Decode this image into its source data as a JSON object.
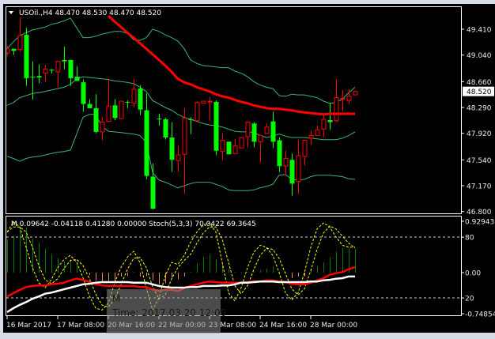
{
  "window": {
    "symbol_header": "USOil.,H4  48.470 48.530 48.470 48.520"
  },
  "colors": {
    "bull": "#ff0000",
    "bear": "#00ff00",
    "bands": "#3cb371",
    "ma": "#ff0000",
    "hist_up": "#008000",
    "hist_down": "#f08060",
    "signal": "#ff0000",
    "main": "#ffffff",
    "stoch": "#ffff00",
    "background": "#000000",
    "current_price_tag": "#ffffff"
  },
  "chart_data": [
    {
      "type": "candlestick",
      "title": "USOil.,H4",
      "ylim": [
        46.8,
        49.63
      ],
      "y_ticks": [
        "49.410",
        "49.040",
        "48.660",
        "48.290",
        "47.920",
        "47.540",
        "47.170",
        "46.800"
      ],
      "current_price": "48.520",
      "candles_ohlc": [
        [
          49.07,
          49.17,
          49.04,
          49.13
        ],
        [
          49.13,
          49.13,
          49.04,
          49.1
        ],
        [
          49.12,
          49.58,
          49.09,
          49.32
        ],
        [
          49.33,
          49.43,
          48.6,
          48.71
        ],
        [
          48.73,
          48.95,
          48.4,
          48.72
        ],
        [
          48.74,
          48.91,
          48.64,
          48.72
        ],
        [
          48.78,
          48.9,
          48.66,
          48.84
        ],
        [
          48.83,
          48.84,
          48.78,
          48.82
        ],
        [
          48.8,
          48.96,
          48.58,
          48.95
        ],
        [
          48.97,
          49.16,
          48.84,
          48.95
        ],
        [
          48.97,
          48.97,
          48.6,
          48.71
        ],
        [
          48.73,
          48.88,
          48.67,
          48.67
        ],
        [
          48.65,
          48.69,
          48.23,
          48.34
        ],
        [
          48.34,
          48.41,
          48.28,
          48.28
        ],
        [
          48.28,
          48.48,
          47.92,
          47.94
        ],
        [
          47.94,
          48.15,
          47.82,
          48.08
        ],
        [
          48.09,
          48.7,
          48.08,
          48.31
        ],
        [
          48.32,
          48.41,
          48.11,
          48.14
        ],
        [
          48.13,
          48.38,
          48.13,
          48.38
        ],
        [
          48.37,
          48.39,
          48.28,
          48.36
        ],
        [
          48.35,
          48.7,
          48.29,
          48.55
        ],
        [
          48.56,
          48.61,
          48.18,
          48.26
        ],
        [
          48.25,
          48.49,
          47.26,
          47.31
        ],
        [
          47.3,
          47.49,
          46.83,
          46.84
        ],
        [
          48.13,
          48.2,
          48.03,
          48.12
        ],
        [
          48.12,
          48.14,
          47.83,
          47.86
        ],
        [
          47.86,
          48.08,
          47.37,
          47.54
        ],
        [
          47.53,
          47.75,
          47.37,
          47.61
        ],
        [
          47.62,
          48.28,
          47.05,
          48.14
        ],
        [
          48.12,
          48.15,
          47.91,
          48.11
        ],
        [
          48.1,
          48.38,
          48.1,
          48.36
        ],
        [
          48.35,
          48.38,
          48.35,
          48.38
        ],
        [
          48.37,
          48.44,
          48.1,
          48.38
        ],
        [
          48.37,
          48.39,
          47.61,
          47.67
        ],
        [
          47.66,
          47.92,
          47.54,
          47.82
        ],
        [
          47.8,
          47.8,
          47.62,
          47.62
        ],
        [
          47.63,
          47.84,
          47.63,
          47.74
        ],
        [
          47.71,
          47.86,
          47.71,
          47.86
        ],
        [
          47.87,
          48.08,
          47.72,
          48.08
        ],
        [
          48.06,
          48.08,
          47.72,
          47.8
        ],
        [
          47.8,
          47.89,
          47.5,
          47.89
        ],
        [
          47.92,
          48.06,
          47.92,
          48.01
        ],
        [
          48.09,
          48.23,
          47.71,
          47.8
        ],
        [
          47.82,
          47.86,
          47.37,
          47.45
        ],
        [
          47.45,
          47.67,
          47.31,
          47.56
        ],
        [
          47.54,
          47.63,
          47.03,
          47.2
        ],
        [
          47.23,
          47.82,
          47.05,
          47.6
        ],
        [
          47.59,
          47.82,
          47.46,
          47.82
        ],
        [
          47.85,
          47.96,
          47.76,
          47.89
        ],
        [
          47.89,
          48.03,
          47.89,
          47.97
        ],
        [
          47.98,
          48.21,
          47.86,
          48.12
        ],
        [
          48.11,
          48.36,
          47.97,
          48.08
        ],
        [
          48.1,
          48.7,
          48.08,
          48.43
        ],
        [
          48.41,
          48.54,
          48.23,
          48.42
        ],
        [
          48.39,
          48.55,
          48.34,
          48.45
        ],
        [
          48.47,
          48.53,
          48.47,
          48.52
        ]
      ],
      "moving_average": [
        null,
        null,
        null,
        null,
        null,
        null,
        null,
        null,
        null,
        null,
        null,
        null,
        null,
        null,
        null,
        null,
        49.6,
        49.52,
        49.44,
        49.36,
        49.29,
        49.21,
        49.13,
        49.05,
        48.97,
        48.89,
        48.8,
        48.7,
        48.65,
        48.62,
        48.58,
        48.55,
        48.52,
        48.48,
        48.45,
        48.43,
        48.4,
        48.37,
        48.35,
        48.32,
        48.3,
        48.28,
        48.27,
        48.27,
        48.26,
        48.25,
        48.23,
        48.22,
        48.21,
        48.2,
        48.19,
        48.2,
        48.2,
        48.2,
        48.2,
        48.2
      ],
      "bollinger_upper": [
        49.13,
        49.23,
        49.32,
        49.36,
        49.4,
        49.42,
        49.44,
        49.48,
        49.5,
        49.53,
        49.57,
        49.43,
        49.29,
        49.29,
        49.31,
        49.34,
        49.36,
        49.38,
        49.38,
        49.35,
        49.26,
        49.25,
        49.29,
        49.41,
        49.38,
        49.33,
        49.29,
        49.24,
        49.13,
        48.97,
        48.92,
        48.89,
        48.88,
        48.87,
        48.86,
        48.86,
        48.81,
        48.78,
        48.73,
        48.66,
        48.61,
        48.58,
        48.56,
        48.46,
        48.45,
        48.48,
        48.47,
        48.47,
        48.45,
        48.43,
        48.38,
        48.35,
        48.36,
        48.41,
        48.5,
        48.58
      ],
      "bollinger_middle": [
        48.32,
        48.36,
        48.43,
        48.46,
        48.49,
        48.5,
        48.52,
        48.54,
        48.56,
        48.58,
        48.62,
        48.7,
        48.73,
        48.72,
        48.71,
        48.7,
        48.69,
        48.67,
        48.66,
        48.65,
        48.63,
        48.58,
        48.52,
        48.39,
        48.34,
        48.29,
        48.25,
        48.19,
        48.15,
        48.12,
        48.09,
        48.06,
        48.04,
        48.03,
        48.01,
        47.98,
        47.95,
        47.94,
        47.94,
        47.93,
        47.89,
        47.86,
        47.88,
        47.91,
        47.88,
        47.86,
        47.86,
        47.86,
        47.85,
        47.84,
        47.83,
        47.83,
        47.83,
        47.85,
        47.89,
        47.94
      ],
      "bollinger_lower": [
        47.59,
        47.56,
        47.52,
        47.56,
        47.58,
        47.59,
        47.61,
        47.63,
        47.65,
        47.66,
        47.68,
        47.91,
        48.15,
        48.19,
        48.19,
        48.02,
        47.95,
        47.94,
        47.93,
        47.92,
        47.91,
        47.89,
        47.79,
        47.36,
        47.25,
        47.22,
        47.18,
        47.14,
        47.17,
        47.2,
        47.22,
        47.22,
        47.22,
        47.19,
        47.16,
        47.11,
        47.1,
        47.1,
        47.1,
        47.11,
        47.14,
        47.16,
        47.19,
        47.32,
        47.33,
        47.26,
        47.25,
        47.26,
        47.3,
        47.32,
        47.32,
        47.32,
        47.31,
        47.3,
        47.27,
        47.26
      ],
      "x_ticks": [
        "16 Mar 2017",
        "17 Mar 08:00",
        "20 Mar 16:00",
        "22 Mar 00:00",
        "23 Mar 08:00",
        "24 Mar 16:00",
        "28 Mar 00:00"
      ]
    },
    {
      "type": "indicator",
      "header": "M 0.09642 -0.04118 0.41280 0.00000  Stoch(5,3,3) 70.0422 69.3645",
      "ylim": [
        -0.74854,
        0.92943
      ],
      "y_ticks": [
        "0.92943",
        "80",
        "0.00",
        "20",
        "-0.74854"
      ],
      "stoch_levels": [
        80,
        20
      ],
      "histogram": [
        0.6,
        0.67,
        0.78,
        0.81,
        0.61,
        0.54,
        0.43,
        0.33,
        0.26,
        0.2,
        0.24,
        0.14,
        0.04,
        -0.04,
        -0.14,
        -0.16,
        -0.18,
        -0.19,
        -0.07,
        -0.06,
        0.02,
        -0.07,
        -0.06,
        -0.14,
        -0.21,
        -0.19,
        -0.09,
        -0.12,
        -0.07,
        0.02,
        0.17,
        0.28,
        0.33,
        0.24,
        0.17,
        0.07,
        0.02,
        0.01,
        0.01,
        0.01,
        0.04,
        0.07,
        0.11,
        0.02,
        0.01,
        -0.1,
        -0.07,
        -0.07,
        0.07,
        0.11,
        0.18,
        0.27,
        0.38,
        0.44,
        0.44,
        0.43
      ],
      "signal_line": [
        -0.43,
        -0.37,
        -0.31,
        -0.26,
        -0.24,
        -0.23,
        -0.23,
        -0.21,
        -0.2,
        -0.18,
        -0.14,
        -0.11,
        -0.13,
        -0.17,
        -0.21,
        -0.23,
        -0.24,
        -0.24,
        -0.24,
        -0.24,
        -0.24,
        -0.26,
        -0.26,
        -0.3,
        -0.33,
        -0.31,
        -0.31,
        -0.33,
        -0.28,
        -0.24,
        -0.21,
        -0.18,
        -0.16,
        -0.17,
        -0.18,
        -0.18,
        -0.18,
        -0.18,
        -0.17,
        -0.16,
        -0.16,
        -0.14,
        -0.14,
        -0.16,
        -0.17,
        -0.2,
        -0.21,
        -0.21,
        -0.18,
        -0.14,
        -0.1,
        -0.04,
        -0.01,
        0.01,
        0.06,
        0.1
      ],
      "main_line": [
        -0.71,
        -0.64,
        -0.58,
        -0.53,
        -0.47,
        -0.43,
        -0.38,
        -0.36,
        -0.33,
        -0.3,
        -0.27,
        -0.24,
        -0.21,
        -0.2,
        -0.18,
        -0.17,
        -0.17,
        -0.17,
        -0.17,
        -0.17,
        -0.18,
        -0.18,
        -0.18,
        -0.21,
        -0.24,
        -0.26,
        -0.27,
        -0.27,
        -0.27,
        -0.26,
        -0.26,
        -0.24,
        -0.24,
        -0.24,
        -0.23,
        -0.23,
        -0.21,
        -0.18,
        -0.18,
        -0.17,
        -0.16,
        -0.16,
        -0.16,
        -0.17,
        -0.17,
        -0.17,
        -0.17,
        -0.17,
        -0.16,
        -0.16,
        -0.14,
        -0.13,
        -0.11,
        -0.1,
        -0.07,
        -0.07
      ],
      "stoch_main": [
        85,
        95,
        90,
        70,
        50,
        35,
        30,
        38,
        50,
        58,
        62,
        55,
        40,
        22,
        10,
        8,
        15,
        35,
        50,
        60,
        66,
        55,
        30,
        8,
        20,
        42,
        55,
        53,
        62,
        75,
        85,
        92,
        94,
        85,
        55,
        25,
        17,
        30,
        50,
        65,
        72,
        70,
        62,
        45,
        25,
        18,
        25,
        45,
        70,
        88,
        94,
        90,
        80,
        72,
        70,
        70.04
      ],
      "stoch_signal": [
        85,
        90,
        90,
        85,
        70,
        52,
        38,
        34,
        39,
        49,
        57,
        58,
        52,
        39,
        24,
        13,
        11,
        19,
        33,
        48,
        59,
        60,
        50,
        31,
        19,
        23,
        39,
        50,
        57,
        63,
        74,
        84,
        90,
        90,
        78,
        55,
        32,
        24,
        32,
        48,
        62,
        69,
        68,
        59,
        44,
        29,
        23,
        29,
        47,
        68,
        84,
        91,
        88,
        81,
        74,
        69.36
      ]
    }
  ],
  "tooltip": {
    "line1": "M",
    "line2": "Time: 2017.03.20 12:00"
  }
}
